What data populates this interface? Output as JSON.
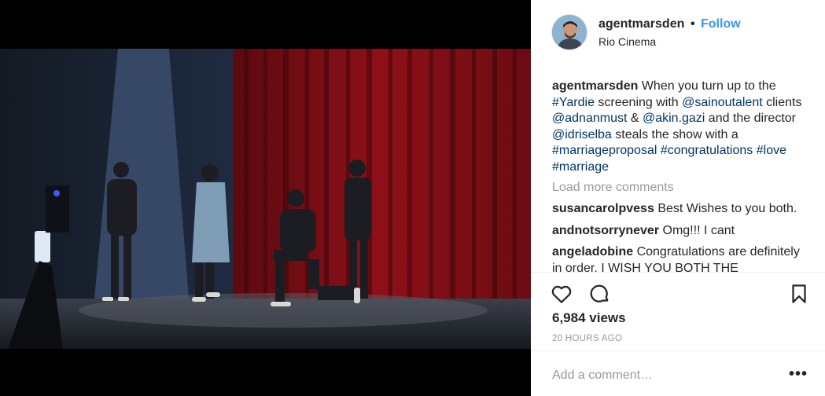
{
  "post": {
    "author": "agentmarsden",
    "follow_label": "Follow",
    "separator": "•",
    "location": "Rio Cinema"
  },
  "caption": {
    "user": "agentmarsden",
    "seg1": " When you turn up to the ",
    "tag1": "#Yardie",
    "seg2": " screening with ",
    "tag2": "@sainoutalent",
    "seg3": " clients ",
    "tag3": "@adnanmust",
    "seg4": " & ",
    "tag4": "@akin.gazi",
    "seg5": " and the director ",
    "tag5": "@idriselba",
    "seg6": " steals the show with a ",
    "tag6": "#marriageproposal",
    "seg7": " ",
    "tag7": "#congratulations",
    "seg8": " ",
    "tag8": "#love",
    "seg9": " ",
    "tag9": "#marriage"
  },
  "load_more": "Load more comments",
  "comments": [
    {
      "user": "susancarolpvess",
      "text": "Best Wishes to you both."
    },
    {
      "user": "andnotsorrynever",
      "text": "Omg!!! I cant"
    },
    {
      "user": "angeladobine",
      "text": "Congratulations are definitely in order. I WISH YOU BOTH THE"
    }
  ],
  "stats": {
    "views": "6,984 views",
    "time_ago": "20 HOURS AGO"
  },
  "add_comment": {
    "placeholder": "Add a comment…",
    "more": "•••"
  },
  "icons": [
    "heart-icon",
    "comment-icon",
    "bookmark-icon"
  ],
  "colors": {
    "link": "#003569",
    "follow": "#3897f0",
    "muted": "#999999",
    "curtain": "#8e1018"
  }
}
